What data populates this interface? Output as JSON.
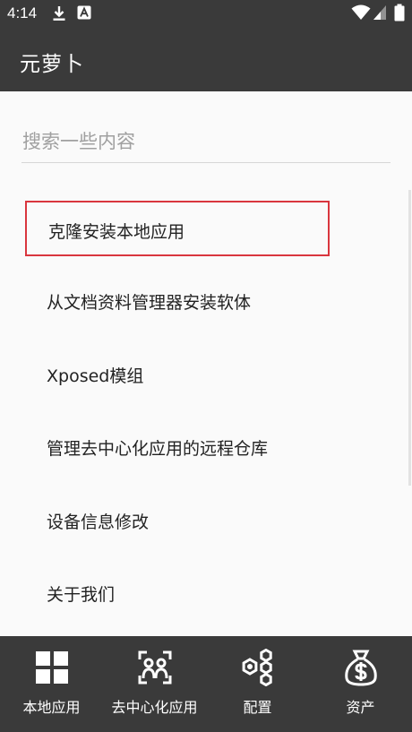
{
  "status_bar": {
    "time": "4:14",
    "left_icons": [
      "download-icon",
      "app-notification-icon"
    ],
    "right_icons": [
      "wifi-icon",
      "signal-icon",
      "battery-icon"
    ]
  },
  "app_bar": {
    "title": "元萝卜"
  },
  "search": {
    "placeholder": "搜索一些内容"
  },
  "menu": {
    "items": [
      {
        "label": "克隆安装本地应用",
        "highlighted": true
      },
      {
        "label": "从文档资料管理器安装软体"
      },
      {
        "label": "Xposed模组"
      },
      {
        "label": "管理去中心化应用的远程仓库"
      },
      {
        "label": "设备信息修改"
      },
      {
        "label": "关于我们"
      }
    ]
  },
  "bottom_nav": {
    "items": [
      {
        "label": "本地应用",
        "icon": "grid-icon"
      },
      {
        "label": "去中心化应用",
        "icon": "people-icon"
      },
      {
        "label": "配置",
        "icon": "hexagons-icon"
      },
      {
        "label": "资产",
        "icon": "money-bag-icon"
      }
    ]
  },
  "colors": {
    "bar_background": "#3a3a3a",
    "content_background": "#fafafa",
    "highlight_border": "#d9363e",
    "text_primary": "#222222",
    "placeholder": "#a0a0a0"
  }
}
